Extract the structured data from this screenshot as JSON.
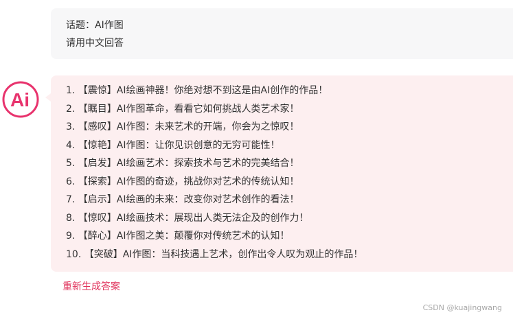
{
  "user_message": {
    "line1": "话题：AI作图",
    "line2": "请用中文回答"
  },
  "assistant": {
    "avatar_text": "Ai",
    "avatar_color": "#e8336d",
    "bubble_color": "#fdeff0",
    "items": [
      "1. 【震惊】AI绘画神器！你绝对想不到这是由AI创作的作品！",
      "2. 【瞩目】AI作图革命，看看它如何挑战人类艺术家！",
      "3. 【感叹】AI作图：未来艺术的开端，你会为之惊叹！",
      "4. 【惊艳】AI作图：让你见识创意的无穷可能性！",
      "5. 【启发】AI绘画艺术：探索技术与艺术的完美结合！",
      "6. 【探索】AI作图的奇迹，挑战你对艺术的传统认知！",
      "7. 【启示】AI绘画的未来：改变你对艺术创作的看法！",
      "8. 【惊叹】AI绘画技术：展现出人类无法企及的创作力！",
      "9. 【醉心】AI作图之美：颠覆你对传统艺术的认知！",
      "10. 【突破】AI作图：当科技遇上艺术，创作出令人叹为观止的作品！"
    ]
  },
  "regenerate_label": "重新生成答案",
  "regenerate_color": "#e0325b",
  "watermark": "CSDN @kuajingwang"
}
